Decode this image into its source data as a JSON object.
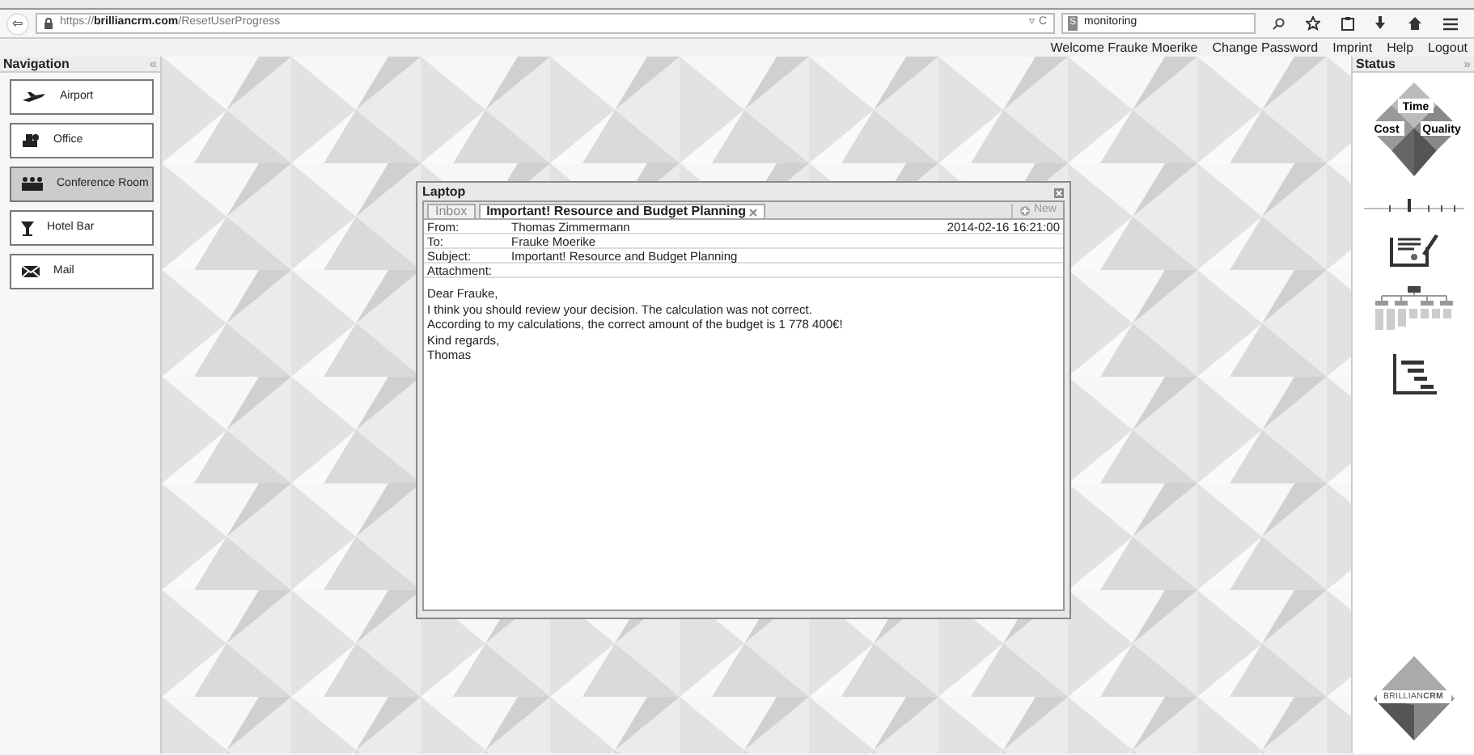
{
  "browser": {
    "back": "⇦",
    "url": "https://**brilliancrm.com**/ResetUserProgress",
    "reload": "▿ C",
    "search": "monitoring",
    "search_engine": "S"
  },
  "header": {
    "welcome": "Welcome Frauke Moerike",
    "links": [
      "Change Password",
      "Imprint",
      "Help",
      "Logout"
    ]
  },
  "navigation": {
    "title": "Navigation",
    "collapse": "«",
    "items": [
      {
        "kind": "airport",
        "label": "Airport",
        "selected": false
      },
      {
        "kind": "office",
        "label": "Office",
        "selected": false
      },
      {
        "kind": "conference",
        "label": "Conference Room",
        "selected": true
      },
      {
        "kind": "bar",
        "label": "Hotel Bar",
        "selected": false
      },
      {
        "kind": "mail",
        "label": "Mail",
        "selected": false
      }
    ]
  },
  "dialog": {
    "title": "Laptop",
    "tabs": [
      {
        "label": "Inbox",
        "selected": false,
        "closable": false
      },
      {
        "label": "Important! Resource and Budget Planning",
        "selected": true,
        "closable": true
      }
    ],
    "new_button": "New",
    "fields": [
      {
        "label": "From:",
        "value": "Thomas Zimmermann",
        "date": "2014-02-16 16:21:00"
      },
      {
        "label": "To:",
        "value": "Frauke Moerike"
      },
      {
        "label": "Subject:",
        "value": "Important! Resource and Budget Planning"
      },
      {
        "label": "Attachment:"
      }
    ],
    "body": [
      "Dear Frauke,",
      "I think you should review your decision. The calculation was not correct.",
      "According to my calculations, the correct amount of the budget is 1 778 400€!",
      "Kind regards,",
      "Thomas"
    ]
  },
  "status": {
    "title": "Status",
    "collapse": "»",
    "triangle": [
      "Time",
      "Cost",
      "Quality"
    ],
    "slider": {
      "level": 0.45
    },
    "logo": "BRILLIAN**CRM**"
  }
}
